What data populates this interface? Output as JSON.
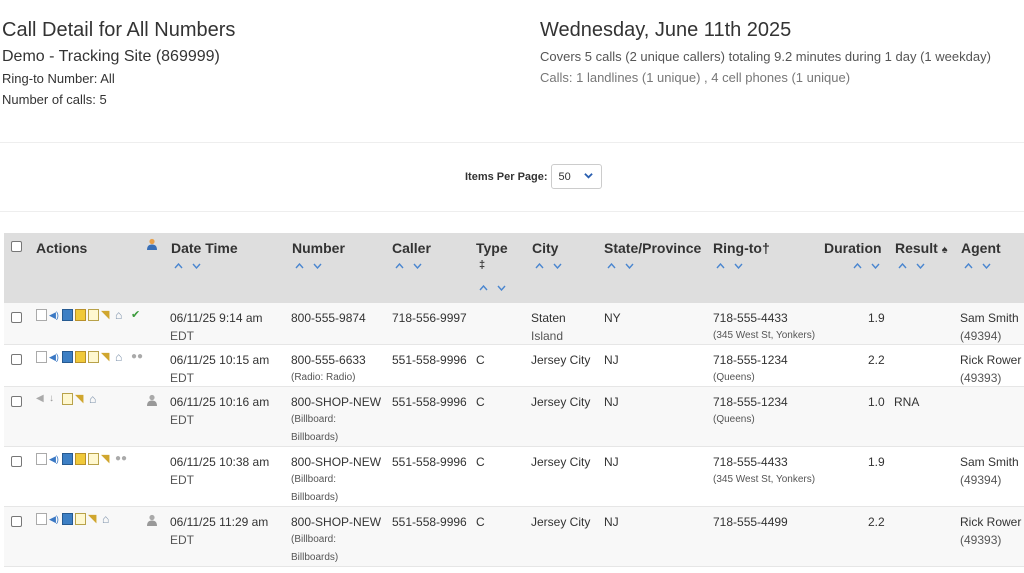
{
  "header": {
    "title": "Call Detail for All Numbers",
    "site": "Demo - Tracking Site (869999)",
    "ring_to": "Ring-to Number: All",
    "num_calls": "Number of calls: 5",
    "date": "Wednesday, June 11th 2025",
    "summary": "Covers 5 calls (2 unique callers) totaling 9.2 minutes during 1 day (1 weekday)",
    "calls_breakdown": "Calls: 1 landlines (1 unique) , 4 cell phones (1 unique)"
  },
  "pager": {
    "label": "Items Per Page:",
    "value": "50"
  },
  "table": {
    "columns": {
      "actions": "Actions",
      "datetime": "Date Time",
      "number": "Number",
      "caller": "Caller",
      "type": "Type",
      "type_mark": "‡",
      "city": "City",
      "state": "State/Province",
      "ringto": "Ring-to†",
      "duration": "Duration",
      "result": "Result",
      "result_mark": "♠",
      "agent": "Agent"
    },
    "rows": [
      {
        "datetime": "06/11/25 9:14 am",
        "tz": "EDT",
        "number": "800-555-9874",
        "number_sub": "",
        "number_sub2": "",
        "caller": "718-556-9997",
        "type": "",
        "city": "Staten",
        "city2": "Island",
        "state": "NY",
        "ringto": "718-555-4433",
        "ringto_sub": "(345 West St, Yonkers)",
        "duration": "1.9",
        "result": "",
        "agent": "Sam Smith",
        "agent_id": "(49394)"
      },
      {
        "datetime": "06/11/25 10:15 am",
        "tz": "EDT",
        "number": "800-555-6633",
        "number_sub": "(Radio: Radio)",
        "number_sub2": "",
        "caller": "551-558-9996",
        "type": "C",
        "city": "Jersey City",
        "city2": "",
        "state": "NJ",
        "ringto": "718-555-1234",
        "ringto_sub": "(Queens)",
        "duration": "2.2",
        "result": "",
        "agent": "Rick Rower",
        "agent_id": "(49393)"
      },
      {
        "datetime": "06/11/25 10:16 am",
        "tz": "EDT",
        "number": "800-SHOP-NEW",
        "number_sub": "(Billboard:",
        "number_sub2": "Billboards)",
        "caller": "551-558-9996",
        "type": "C",
        "city": "Jersey City",
        "city2": "",
        "state": "NJ",
        "ringto": "718-555-1234",
        "ringto_sub": "(Queens)",
        "duration": "1.0",
        "result": "RNA",
        "agent": "",
        "agent_id": ""
      },
      {
        "datetime": "06/11/25 10:38 am",
        "tz": "EDT",
        "number": "800-SHOP-NEW",
        "number_sub": "(Billboard:",
        "number_sub2": "Billboards)",
        "caller": "551-558-9996",
        "type": "C",
        "city": "Jersey City",
        "city2": "",
        "state": "NJ",
        "ringto": "718-555-4433",
        "ringto_sub": "(345 West St, Yonkers)",
        "duration": "1.9",
        "result": "",
        "agent": "Sam Smith",
        "agent_id": "(49394)"
      },
      {
        "datetime": "06/11/25 11:29 am",
        "tz": "EDT",
        "number": "800-SHOP-NEW",
        "number_sub": "(Billboard:",
        "number_sub2": "Billboards)",
        "caller": "551-558-9996",
        "type": "C",
        "city": "Jersey City",
        "city2": "",
        "state": "NJ",
        "ringto": "718-555-4499",
        "ringto_sub": "",
        "duration": "2.2",
        "result": "",
        "agent": "Rick Rower",
        "agent_id": "(49393)"
      }
    ]
  },
  "colors": {
    "header_bg": "#dedede",
    "accent": "#3a78c4"
  }
}
